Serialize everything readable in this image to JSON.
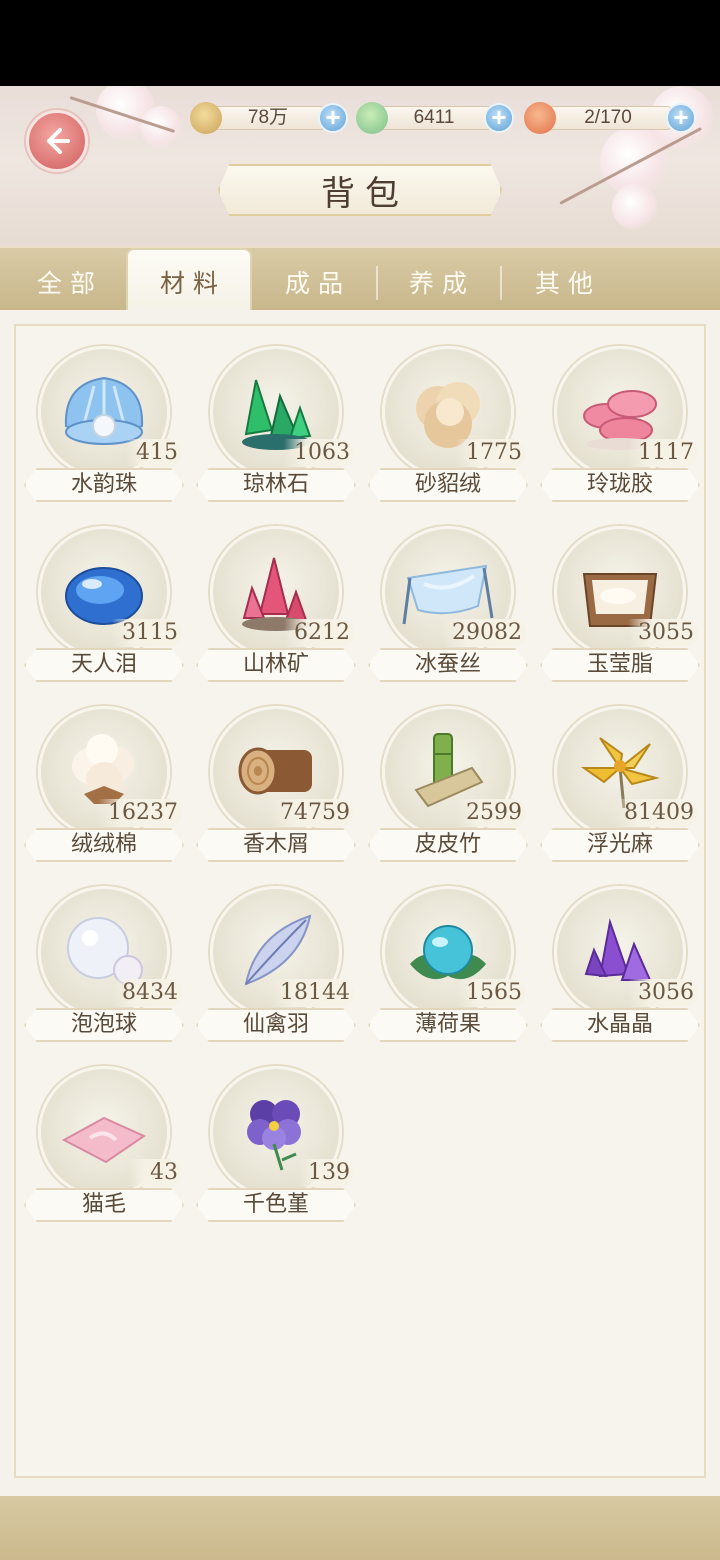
{
  "header": {
    "title": "背包",
    "currencies": [
      {
        "name": "paw-coin-icon",
        "value": "78万"
      },
      {
        "name": "green-bird-icon",
        "value": "6411"
      },
      {
        "name": "orange-bun-icon",
        "value": "2/170"
      }
    ]
  },
  "tabs": [
    {
      "label": "全部",
      "active": false
    },
    {
      "label": "材料",
      "active": true
    },
    {
      "label": "成品",
      "active": false
    },
    {
      "label": "养成",
      "active": false
    },
    {
      "label": "其他",
      "active": false
    }
  ],
  "items": [
    {
      "name": "水韵珠",
      "count": "415",
      "icon": "pearl-shell-icon"
    },
    {
      "name": "琼林石",
      "count": "1063",
      "icon": "green-crystal-icon"
    },
    {
      "name": "砂貂绒",
      "count": "1775",
      "icon": "fur-tuft-icon"
    },
    {
      "name": "玲珑胶",
      "count": "1117",
      "icon": "pink-mushroom-icon"
    },
    {
      "name": "天人泪",
      "count": "3115",
      "icon": "blue-gem-icon"
    },
    {
      "name": "山林矿",
      "count": "6212",
      "icon": "pink-crystal-icon"
    },
    {
      "name": "冰蚕丝",
      "count": "29082",
      "icon": "silk-cloth-icon"
    },
    {
      "name": "玉莹脂",
      "count": "3055",
      "icon": "wooden-box-icon"
    },
    {
      "name": "绒绒棉",
      "count": "16237",
      "icon": "cotton-icon"
    },
    {
      "name": "香木屑",
      "count": "74759",
      "icon": "wood-log-icon"
    },
    {
      "name": "皮皮竹",
      "count": "2599",
      "icon": "bamboo-icon"
    },
    {
      "name": "浮光麻",
      "count": "81409",
      "icon": "yellow-flower-icon"
    },
    {
      "name": "泡泡球",
      "count": "8434",
      "icon": "bubble-icon"
    },
    {
      "name": "仙禽羽",
      "count": "18144",
      "icon": "feather-icon"
    },
    {
      "name": "薄荷果",
      "count": "1565",
      "icon": "mint-fruit-icon"
    },
    {
      "name": "水晶晶",
      "count": "3056",
      "icon": "purple-crystal-icon"
    },
    {
      "name": "猫毛",
      "count": "43",
      "icon": "cat-fur-icon"
    },
    {
      "name": "千色堇",
      "count": "139",
      "icon": "pansy-icon"
    }
  ]
}
